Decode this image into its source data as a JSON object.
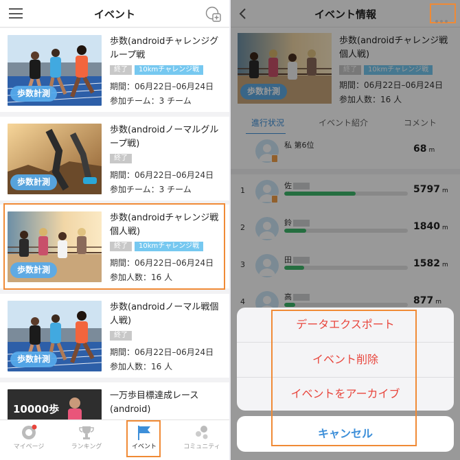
{
  "left": {
    "header": {
      "title": "イベント"
    },
    "events": [
      {
        "title": "歩数(androidチャレンジグループ戦",
        "tags": [
          "終了",
          "10kmチャレンジ戦"
        ],
        "period": "期間：06月22日–06月24日",
        "meta": "参加チーム：3 チーム",
        "badge": "歩数計測"
      },
      {
        "title": "歩数(androidノーマルグループ戦)",
        "tags": [
          "終了"
        ],
        "period": "期間：06月22日–06月24日",
        "meta": "参加チーム：3 チーム",
        "badge": "歩数計測"
      },
      {
        "title": "歩数(androidチャレンジ戦個人戦)",
        "tags": [
          "終了",
          "10kmチャレンジ戦"
        ],
        "period": "期間：06月22日–06月24日",
        "meta": "参加人数：16 人",
        "badge": "歩数計測"
      },
      {
        "title": "歩数(androidノーマル戦個人戦)",
        "tags": [
          "終了"
        ],
        "period": "期間：06月22日–06月24日",
        "meta": "参加人数：16 人",
        "badge": "歩数計測"
      },
      {
        "title": "一万歩目標達成レース(android)",
        "thumb_text": "10000歩"
      }
    ],
    "tabbar": [
      {
        "label": "マイページ"
      },
      {
        "label": "ランキング"
      },
      {
        "label": "イベント"
      },
      {
        "label": "コミュニティ"
      }
    ]
  },
  "right": {
    "header": {
      "title": "イベント情報"
    },
    "event": {
      "title": "歩数(androidチャレンジ戦個人戦)",
      "tags": [
        "終了",
        "10kmチャレンジ戦"
      ],
      "period": "期間：06月22日–06月24日",
      "meta": "参加人数：16 人",
      "badge": "歩数計測"
    },
    "tabs": [
      "進行状況",
      "イベント紹介",
      "コメント"
    ],
    "my_rank": {
      "label": "私 第6位",
      "steps": "68",
      "unit": "m"
    },
    "ranking": [
      {
        "rank": "1",
        "name": "佐",
        "steps": "5797",
        "unit": "m",
        "progress": 0.58
      },
      {
        "rank": "2",
        "name": "鈴",
        "steps": "1840",
        "unit": "m",
        "progress": 0.18
      },
      {
        "rank": "3",
        "name": "田",
        "steps": "1582",
        "unit": "m",
        "progress": 0.16
      },
      {
        "rank": "4",
        "name": "高",
        "steps": "877",
        "unit": "m",
        "progress": 0.09
      }
    ],
    "action_sheet": {
      "items": [
        "データエクスポート",
        "イベント削除",
        "イベントをアーカイブ"
      ],
      "cancel": "キャンセル"
    }
  },
  "colors": {
    "accent_blue": "#3d8fd9",
    "highlight_orange": "#f08a35",
    "danger_red": "#e8453c",
    "progress_green": "#3fb86b"
  }
}
